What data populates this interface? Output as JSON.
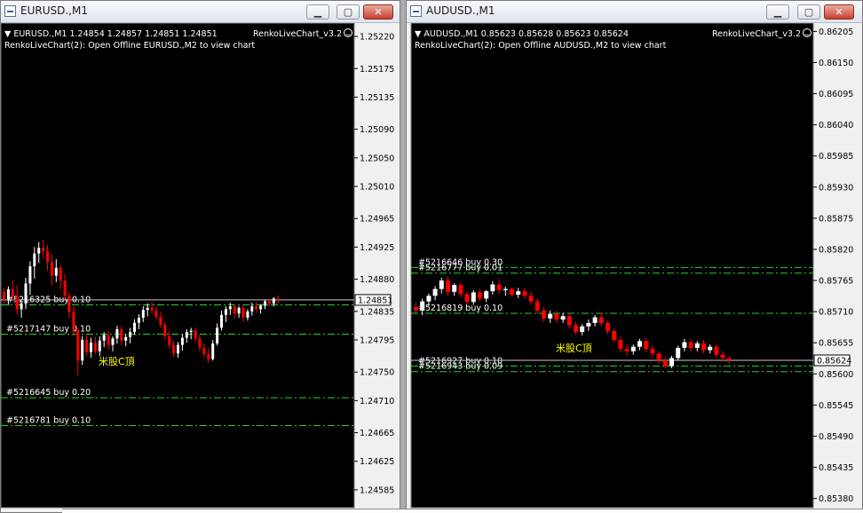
{
  "windows": [
    {
      "title": "EURUSD.,M1",
      "buttons": {
        "minimize": "▁",
        "maximize": "▢",
        "close": "✕"
      },
      "colors": {
        "background": "#000000",
        "candle_up": "#ffffff",
        "candle_down": "#ff0000",
        "order_line": "#28d228",
        "axis_text": "#000000",
        "info_text": "#ffffff",
        "annotation": "#ffff00"
      },
      "chart_data": {
        "type": "candlestick",
        "header": "▼ EURUSD.,M1  1.24854 1.24857 1.24851 1.24851",
        "subheader": "RenkoLiveChart(2): Open Offline EURUSD.,M2 to view chart",
        "indicator_label": "RenkoLiveChart_v3.2",
        "ylim": [
          1.24565,
          1.25235
        ],
        "y_ticks": [
          "1.25220",
          "1.25175",
          "1.25135",
          "1.25090",
          "1.25050",
          "1.25010",
          "1.24965",
          "1.24925",
          "1.24880",
          "1.24835",
          "1.24795",
          "1.24750",
          "1.24710",
          "1.24665",
          "1.24625",
          "1.24585"
        ],
        "current_price": "1.24851",
        "orders": [
          {
            "label": "#5216325 buy 0.10",
            "price": 1.24844
          },
          {
            "label": "#5217147 buy 0.10",
            "price": 1.24803
          },
          {
            "label": "#5216645 buy 0.20",
            "price": 1.24714
          },
          {
            "label": "#5216781 buy 0.10",
            "price": 1.24675
          }
        ],
        "annotation": "米股C頂",
        "candles": [
          [
            1.24862,
            1.24868,
            1.24846,
            1.24852
          ],
          [
            1.24852,
            1.2487,
            1.24844,
            1.24866
          ],
          [
            1.24866,
            1.24879,
            1.2485,
            1.24856
          ],
          [
            1.24856,
            1.24872,
            1.2483,
            1.24838
          ],
          [
            1.24838,
            1.2485,
            1.24826,
            1.24846
          ],
          [
            1.24846,
            1.24882,
            1.24838,
            1.24874
          ],
          [
            1.24874,
            1.24905,
            1.24858,
            1.24898
          ],
          [
            1.24898,
            1.24925,
            1.24881,
            1.24916
          ],
          [
            1.24916,
            1.24932,
            1.24903,
            1.24924
          ],
          [
            1.24924,
            1.24935,
            1.24909,
            1.24919
          ],
          [
            1.24919,
            1.24928,
            1.24892,
            1.24904
          ],
          [
            1.24904,
            1.24915,
            1.24871,
            1.24885
          ],
          [
            1.24885,
            1.24908,
            1.24876,
            1.24896
          ],
          [
            1.24896,
            1.24899,
            1.24866,
            1.24878
          ],
          [
            1.24878,
            1.24887,
            1.24852,
            1.24857
          ],
          [
            1.24857,
            1.24861,
            1.24826,
            1.24834
          ],
          [
            1.24834,
            1.24842,
            1.248,
            1.24808
          ],
          [
            1.24808,
            1.24812,
            1.24745,
            1.24766
          ],
          [
            1.24766,
            1.248,
            1.2476,
            1.24795
          ],
          [
            1.24795,
            1.24803,
            1.24772,
            1.24778
          ],
          [
            1.24778,
            1.24798,
            1.2477,
            1.24791
          ],
          [
            1.24791,
            1.24799,
            1.24775,
            1.24779
          ],
          [
            1.24779,
            1.248,
            1.24772,
            1.24794
          ],
          [
            1.24794,
            1.24806,
            1.24785,
            1.24802
          ],
          [
            1.24802,
            1.24807,
            1.24782,
            1.24788
          ],
          [
            1.24788,
            1.248,
            1.24779,
            1.24797
          ],
          [
            1.24797,
            1.24815,
            1.2479,
            1.2481
          ],
          [
            1.2481,
            1.24814,
            1.24788,
            1.24794
          ],
          [
            1.24794,
            1.24803,
            1.24786,
            1.24799
          ],
          [
            1.24799,
            1.24812,
            1.2479,
            1.24806
          ],
          [
            1.24806,
            1.24824,
            1.24802,
            1.24819
          ],
          [
            1.24819,
            1.24831,
            1.2481,
            1.24826
          ],
          [
            1.24826,
            1.24842,
            1.2482,
            1.24837
          ],
          [
            1.24837,
            1.24846,
            1.24828,
            1.2484
          ],
          [
            1.2484,
            1.24848,
            1.24832,
            1.24836
          ],
          [
            1.24836,
            1.24842,
            1.24824,
            1.24827
          ],
          [
            1.24827,
            1.24834,
            1.24812,
            1.24816
          ],
          [
            1.24816,
            1.24821,
            1.24795,
            1.248
          ],
          [
            1.248,
            1.24808,
            1.24783,
            1.24788
          ],
          [
            1.24788,
            1.24794,
            1.24771,
            1.24776
          ],
          [
            1.24776,
            1.24792,
            1.2477,
            1.24788
          ],
          [
            1.24788,
            1.24803,
            1.2478,
            1.24798
          ],
          [
            1.24798,
            1.2481,
            1.24791,
            1.24806
          ],
          [
            1.24806,
            1.24812,
            1.24796,
            1.24808
          ],
          [
            1.24808,
            1.24812,
            1.24792,
            1.24797
          ],
          [
            1.24797,
            1.24802,
            1.24779,
            1.24784
          ],
          [
            1.24784,
            1.2479,
            1.2477,
            1.24775
          ],
          [
            1.24775,
            1.24783,
            1.24763,
            1.24768
          ],
          [
            1.24768,
            1.24795,
            1.24766,
            1.2479
          ],
          [
            1.2479,
            1.24818,
            1.24787,
            1.24812
          ],
          [
            1.24812,
            1.24836,
            1.24808,
            1.2483
          ],
          [
            1.2483,
            1.24842,
            1.2482,
            1.24838
          ],
          [
            1.24838,
            1.24847,
            1.2483,
            1.24842
          ],
          [
            1.24842,
            1.24845,
            1.24826,
            1.24832
          ],
          [
            1.24832,
            1.24842,
            1.24826,
            1.2484
          ],
          [
            1.2484,
            1.24844,
            1.2482,
            1.24826
          ],
          [
            1.24826,
            1.24838,
            1.24822,
            1.24835
          ],
          [
            1.24835,
            1.24847,
            1.24829,
            1.24842
          ],
          [
            1.24842,
            1.24848,
            1.24833,
            1.24838
          ],
          [
            1.24838,
            1.24845,
            1.24832,
            1.24843
          ],
          [
            1.24843,
            1.24851,
            1.24838,
            1.24849
          ],
          [
            1.24849,
            1.24852,
            1.24842,
            1.24846
          ],
          [
            1.24846,
            1.24855,
            1.24842,
            1.24853
          ],
          [
            1.24853,
            1.24857,
            1.24846,
            1.24851
          ]
        ]
      }
    },
    {
      "title": "AUDUSD.,M1",
      "buttons": {
        "minimize": "▁",
        "maximize": "▢",
        "close": "✕"
      },
      "colors": {
        "background": "#000000",
        "candle_up": "#ffffff",
        "candle_down": "#ff0000",
        "order_line": "#28d228",
        "axis_text": "#000000",
        "info_text": "#ffffff",
        "annotation": "#ffff00"
      },
      "chart_data": {
        "type": "candlestick",
        "header": "▼ AUDUSD.,M1  0.85623 0.85628 0.85623 0.85624",
        "subheader": "RenkoLiveChart(2): Open Offline AUDUSD.,M2 to view chart",
        "indicator_label": "RenkoLiveChart_v3.2",
        "ylim": [
          0.8537,
          0.86215
        ],
        "y_ticks": [
          "0.86205",
          "0.86150",
          "0.86095",
          "0.86040",
          "0.85985",
          "0.85930",
          "0.85875",
          "0.85820",
          "0.85765",
          "0.85710",
          "0.85655",
          "0.85600",
          "0.85545",
          "0.85490",
          "0.85435",
          "0.85380"
        ],
        "current_price": "0.85624",
        "orders": [
          {
            "label": "#5216646 buy 0.30",
            "price": 0.85788
          },
          {
            "label": "#5216777 buy 0.01",
            "price": 0.85778
          },
          {
            "label": "#5216819 buy 0.10",
            "price": 0.85707
          },
          {
            "label": "#5216927 buy 0.10",
            "price": 0.85614
          },
          {
            "label": "#5216943 buy 0.09",
            "price": 0.85604
          }
        ],
        "annotation": "米股C頂",
        "candles": [
          [
            0.85718,
            0.85726,
            0.85708,
            0.85712
          ],
          [
            0.85712,
            0.85733,
            0.85704,
            0.85728
          ],
          [
            0.85728,
            0.85742,
            0.8572,
            0.85738
          ],
          [
            0.85738,
            0.85755,
            0.8573,
            0.8575
          ],
          [
            0.8575,
            0.8577,
            0.85742,
            0.85765
          ],
          [
            0.85765,
            0.85772,
            0.85738,
            0.85745
          ],
          [
            0.85745,
            0.8576,
            0.85738,
            0.85757
          ],
          [
            0.85757,
            0.85762,
            0.85735,
            0.85741
          ],
          [
            0.85741,
            0.85745,
            0.85722,
            0.85727
          ],
          [
            0.85727,
            0.85748,
            0.85722,
            0.85744
          ],
          [
            0.85744,
            0.8575,
            0.85728,
            0.85733
          ],
          [
            0.85733,
            0.85748,
            0.85727,
            0.85746
          ],
          [
            0.85746,
            0.85764,
            0.8574,
            0.85758
          ],
          [
            0.85758,
            0.85766,
            0.85742,
            0.85748
          ],
          [
            0.85748,
            0.85754,
            0.85738,
            0.8575
          ],
          [
            0.8575,
            0.85752,
            0.85736,
            0.8574
          ],
          [
            0.8574,
            0.85752,
            0.85734,
            0.85746
          ],
          [
            0.85746,
            0.85752,
            0.85732,
            0.85738
          ],
          [
            0.85738,
            0.85745,
            0.85722,
            0.85728
          ],
          [
            0.85728,
            0.85734,
            0.85706,
            0.85712
          ],
          [
            0.85712,
            0.85718,
            0.85692,
            0.85698
          ],
          [
            0.85698,
            0.85712,
            0.8569,
            0.85706
          ],
          [
            0.85706,
            0.85712,
            0.8569,
            0.85696
          ],
          [
            0.85696,
            0.85708,
            0.8569,
            0.85702
          ],
          [
            0.85702,
            0.85706,
            0.8568,
            0.85686
          ],
          [
            0.85686,
            0.85692,
            0.8567,
            0.85674
          ],
          [
            0.85674,
            0.85688,
            0.85668,
            0.85684
          ],
          [
            0.85684,
            0.85696,
            0.85676,
            0.8569
          ],
          [
            0.8569,
            0.85704,
            0.85684,
            0.857
          ],
          [
            0.857,
            0.85708,
            0.85684,
            0.8569
          ],
          [
            0.8569,
            0.85694,
            0.8567,
            0.85676
          ],
          [
            0.85676,
            0.8568,
            0.85655,
            0.8566
          ],
          [
            0.8566,
            0.85666,
            0.85638,
            0.85644
          ],
          [
            0.85644,
            0.85652,
            0.85632,
            0.8564
          ],
          [
            0.8564,
            0.85652,
            0.85634,
            0.85648
          ],
          [
            0.85648,
            0.85662,
            0.85642,
            0.85658
          ],
          [
            0.85658,
            0.85664,
            0.85638,
            0.85644
          ],
          [
            0.85644,
            0.8565,
            0.8563,
            0.85636
          ],
          [
            0.85636,
            0.8564,
            0.85618,
            0.85624
          ],
          [
            0.85624,
            0.85628,
            0.8561,
            0.85614
          ],
          [
            0.85614,
            0.85632,
            0.8561,
            0.85628
          ],
          [
            0.85628,
            0.8565,
            0.85624,
            0.85646
          ],
          [
            0.85646,
            0.85662,
            0.8564,
            0.85656
          ],
          [
            0.85656,
            0.85662,
            0.8564,
            0.85646
          ],
          [
            0.85646,
            0.85658,
            0.8564,
            0.85654
          ],
          [
            0.85654,
            0.8566,
            0.85636,
            0.85642
          ],
          [
            0.85642,
            0.85652,
            0.85636,
            0.85648
          ],
          [
            0.85648,
            0.85652,
            0.85628,
            0.85634
          ],
          [
            0.85634,
            0.8564,
            0.85622,
            0.85628
          ],
          [
            0.85628,
            0.85632,
            0.85618,
            0.85624
          ]
        ]
      }
    }
  ]
}
